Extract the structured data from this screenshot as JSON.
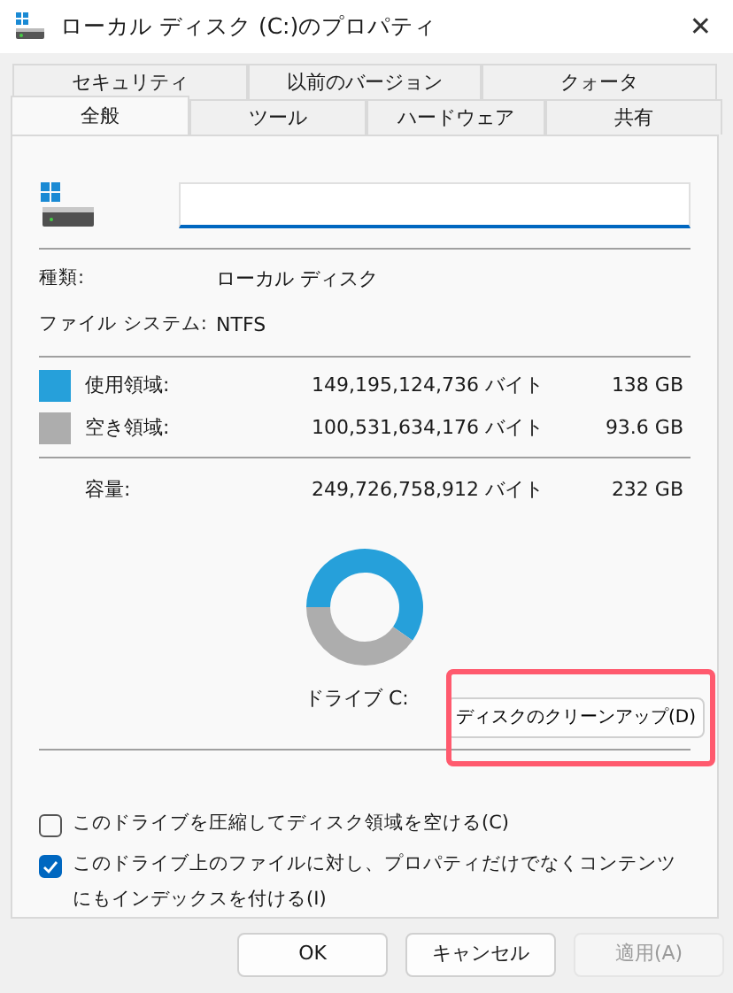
{
  "window": {
    "title": "ローカル ディスク (C:)のプロパティ",
    "close": "✕"
  },
  "tab_rows": [
    [
      {
        "label": "セキュリティ",
        "selected": false
      },
      {
        "label": "以前のバージョン",
        "selected": false
      },
      {
        "label": "クォータ",
        "selected": false
      }
    ],
    [
      {
        "label": "全般",
        "selected": true
      },
      {
        "label": "ツール",
        "selected": false
      },
      {
        "label": "ハードウェア",
        "selected": false
      },
      {
        "label": "共有",
        "selected": false
      }
    ]
  ],
  "info": [
    {
      "label": "種類:",
      "value": "ローカル ディスク"
    },
    {
      "label": "ファイル システム:",
      "value": "NTFS"
    }
  ],
  "usage": [
    {
      "label": "使用領域:",
      "bytes": "149,195,124,736 バイト",
      "size": "138 GB",
      "color": "#26a0da"
    },
    {
      "label": "空き領域:",
      "bytes": "100,531,634,176 バイト",
      "size": "93.6 GB",
      "color": "#adadad"
    }
  ],
  "capacity": {
    "label": "容量:",
    "bytes": "249,726,758,912 バイト",
    "size": "232 GB"
  },
  "chart_data": {
    "type": "donut",
    "values": [
      59.7,
      40.3
    ]
  },
  "drive_label": "ドライブ C:",
  "cleanup_button": {
    "label": "ディスクのクリーンアップ(D)",
    "highlighted": true
  },
  "options": [
    {
      "label": "このドライブを圧縮してディスク領域を空ける(C)",
      "checked": false
    },
    {
      "label": "このドライブ上のファイルに対し、プロパティだけでなくコンテンツにもインデックスを付ける(I)",
      "checked": true
    }
  ],
  "buttons": [
    {
      "label": "OK",
      "disabled": false
    },
    {
      "label": "キャンセル",
      "disabled": false
    },
    {
      "label": "適用(A)",
      "disabled": true
    }
  ]
}
